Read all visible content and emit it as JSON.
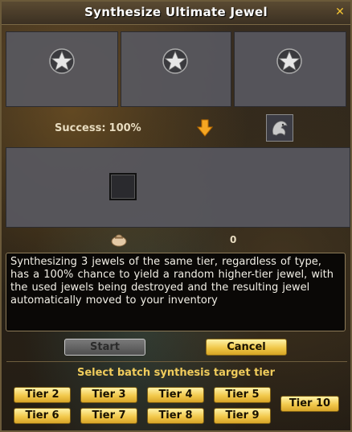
{
  "window": {
    "title": "Synthesize Ultimate Jewel",
    "close_icon": "close-icon"
  },
  "input_slots": [
    {
      "icon": "star-jewel-icon"
    },
    {
      "icon": "star-jewel-icon"
    },
    {
      "icon": "star-jewel-icon"
    }
  ],
  "success": {
    "label": "Success:",
    "value": "100%"
  },
  "arrow_icon": "down-arrow-icon",
  "material_icon": "dragon-emblem-icon",
  "result_slot": {
    "icon": "empty-slot"
  },
  "currency": {
    "icon": "coin-pouch-icon",
    "amount": "0"
  },
  "description": "Synthesizing 3 jewels of the same tier, regardless of type, has a 100% chance to yield a random higher-tier jewel, with the used jewels being destroyed and the resulting jewel automatically moved to your inventory",
  "buttons": {
    "start": "Start",
    "cancel": "Cancel"
  },
  "batch": {
    "label": "Select batch synthesis target tier",
    "tiers": [
      "Tier 2",
      "Tier 3",
      "Tier 4",
      "Tier 5",
      "Tier 6",
      "Tier 7",
      "Tier 8",
      "Tier 9",
      "Tier 10"
    ]
  },
  "colors": {
    "accent_gold": "#f0cc5c",
    "button_gold": "#f2c94c",
    "slot_gray": "#585860"
  }
}
